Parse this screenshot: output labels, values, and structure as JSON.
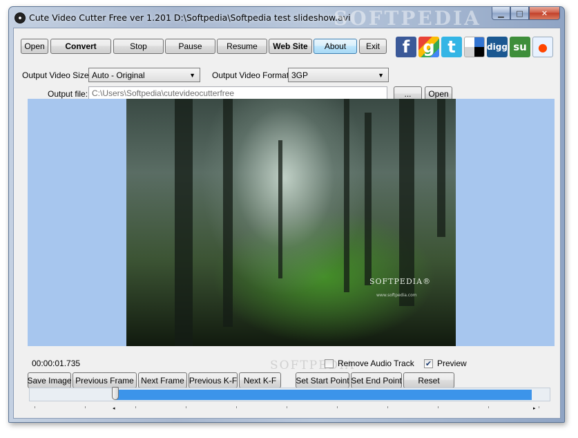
{
  "window": {
    "title": "Cute Video Cutter Free ver 1.201  D:\\Softpedia\\Softpedia test slideshow.avi",
    "watermark": "SOFTPEDIA",
    "controls": {
      "minimize": "▁",
      "maximize": "□",
      "close": "✕"
    }
  },
  "toolbar": {
    "open": "Open",
    "convert": "Convert",
    "stop": "Stop",
    "pause": "Pause",
    "resume": "Resume",
    "website": "Web Site",
    "about": "About",
    "exit": "Exit"
  },
  "social": [
    {
      "name": "facebook-icon",
      "glyph": "f",
      "color": "#3b5998"
    },
    {
      "name": "google-icon",
      "glyph": "g",
      "color": "#4285f4"
    },
    {
      "name": "twitter-icon",
      "glyph": "t",
      "color": "#33b5e5"
    },
    {
      "name": "delicious-icon",
      "glyph": "",
      "color": "#ffffff"
    },
    {
      "name": "digg-icon",
      "glyph": "digg",
      "color": "#1b5891"
    },
    {
      "name": "stumbleupon-icon",
      "glyph": "su",
      "color": "#3e8e3a"
    },
    {
      "name": "reddit-icon",
      "glyph": "●",
      "color": "#ffffff"
    }
  ],
  "settings": {
    "size_label": "Output Video Size:",
    "size_value": "Auto - Original",
    "format_label": "Output Video Format:",
    "format_value": "3GP",
    "file_label": "Output file:",
    "file_value": "C:\\Users\\Softpedia\\cutevideocutterfree",
    "browse": "...",
    "open": "Open"
  },
  "video": {
    "logo": "SOFTPEDIA®",
    "url": "www.softpedia.com"
  },
  "status": {
    "time": "00:00:01.735",
    "remove_audio_label": "Remove Audio Track",
    "remove_audio_checked": false,
    "preview_label": "Preview",
    "preview_checked": true,
    "watermark": "SOFTPEDIA"
  },
  "actions": {
    "save_image": "Save Image",
    "previous_frame": "Previous Frame",
    "next_frame": "Next Frame",
    "previous_kf": "Previous K-F",
    "next_kf": "Next K-F",
    "set_start": "Set  Start Point",
    "set_end": "Set  End Point",
    "reset": "Reset"
  },
  "timeline": {
    "position_fraction": 0.165,
    "range_start_fraction": 0.165,
    "range_end_fraction": 0.99,
    "start_marker": "◂",
    "end_marker": "▸"
  }
}
